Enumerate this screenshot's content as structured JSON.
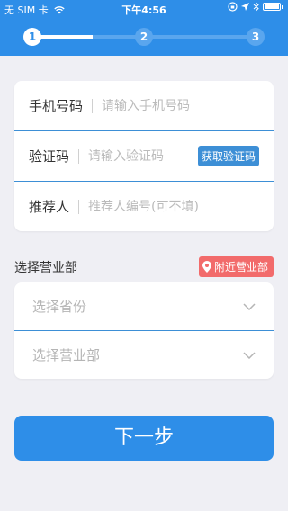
{
  "status": {
    "carrier": "无 SIM 卡",
    "time": "下午4:56"
  },
  "steps": [
    "1",
    "2",
    "3"
  ],
  "progress": {
    "current_step": 1,
    "fill_fraction": 0.27
  },
  "form": {
    "phone": {
      "label": "手机号码",
      "placeholder": "请输入手机号码"
    },
    "code": {
      "label": "验证码",
      "placeholder": "请输入验证码",
      "button": "获取验证码"
    },
    "referrer": {
      "label": "推荐人",
      "placeholder": "推荐人编号(可不填)"
    }
  },
  "branch": {
    "title": "选择营业部",
    "nearby_label": "附近营业部",
    "province_placeholder": "选择省份",
    "branch_placeholder": "选择营业部"
  },
  "next_button": "下一步",
  "colors": {
    "primary": "#2e8ee8",
    "divider_accent": "#3d8fd6",
    "badge_red": "#f26b6b",
    "background": "#efeff4"
  }
}
